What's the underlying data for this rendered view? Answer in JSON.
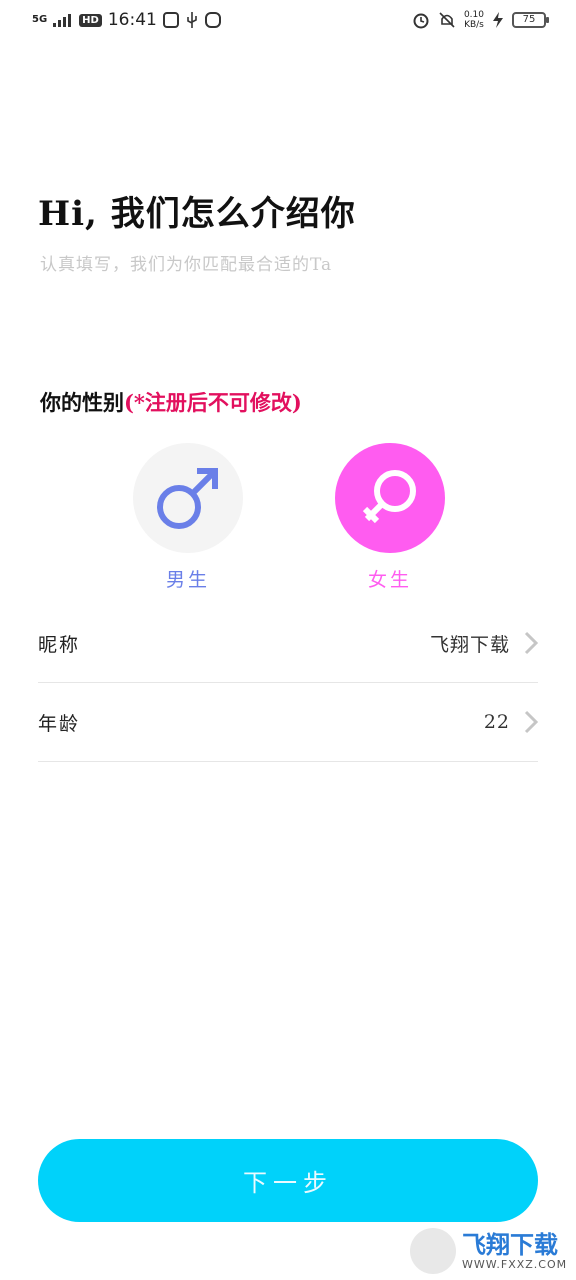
{
  "status_bar": {
    "network": "5G",
    "hd": "HD",
    "time": "16:41",
    "speed_value": "0.10",
    "speed_unit": "KB/s",
    "battery": "75"
  },
  "header": {
    "title": "Hi, 我们怎么介绍你",
    "subtitle": "认真填写，我们为你匹配最合适的Ta"
  },
  "gender": {
    "label": "你的性别",
    "note": "(*注册后不可修改)",
    "male_label": "男生",
    "female_label": "女生",
    "male_color": "#6a7fe8",
    "female_color": "#ff5cf0",
    "selected": "female"
  },
  "form": {
    "nickname_label": "昵称",
    "nickname_value": "飞翔下载",
    "age_label": "年龄",
    "age_value": "22"
  },
  "actions": {
    "next_label": "下一步",
    "button_color": "#00d2fa"
  },
  "watermark": {
    "main": "飞翔下载",
    "sub": "WWW.FXXZ.COM"
  }
}
